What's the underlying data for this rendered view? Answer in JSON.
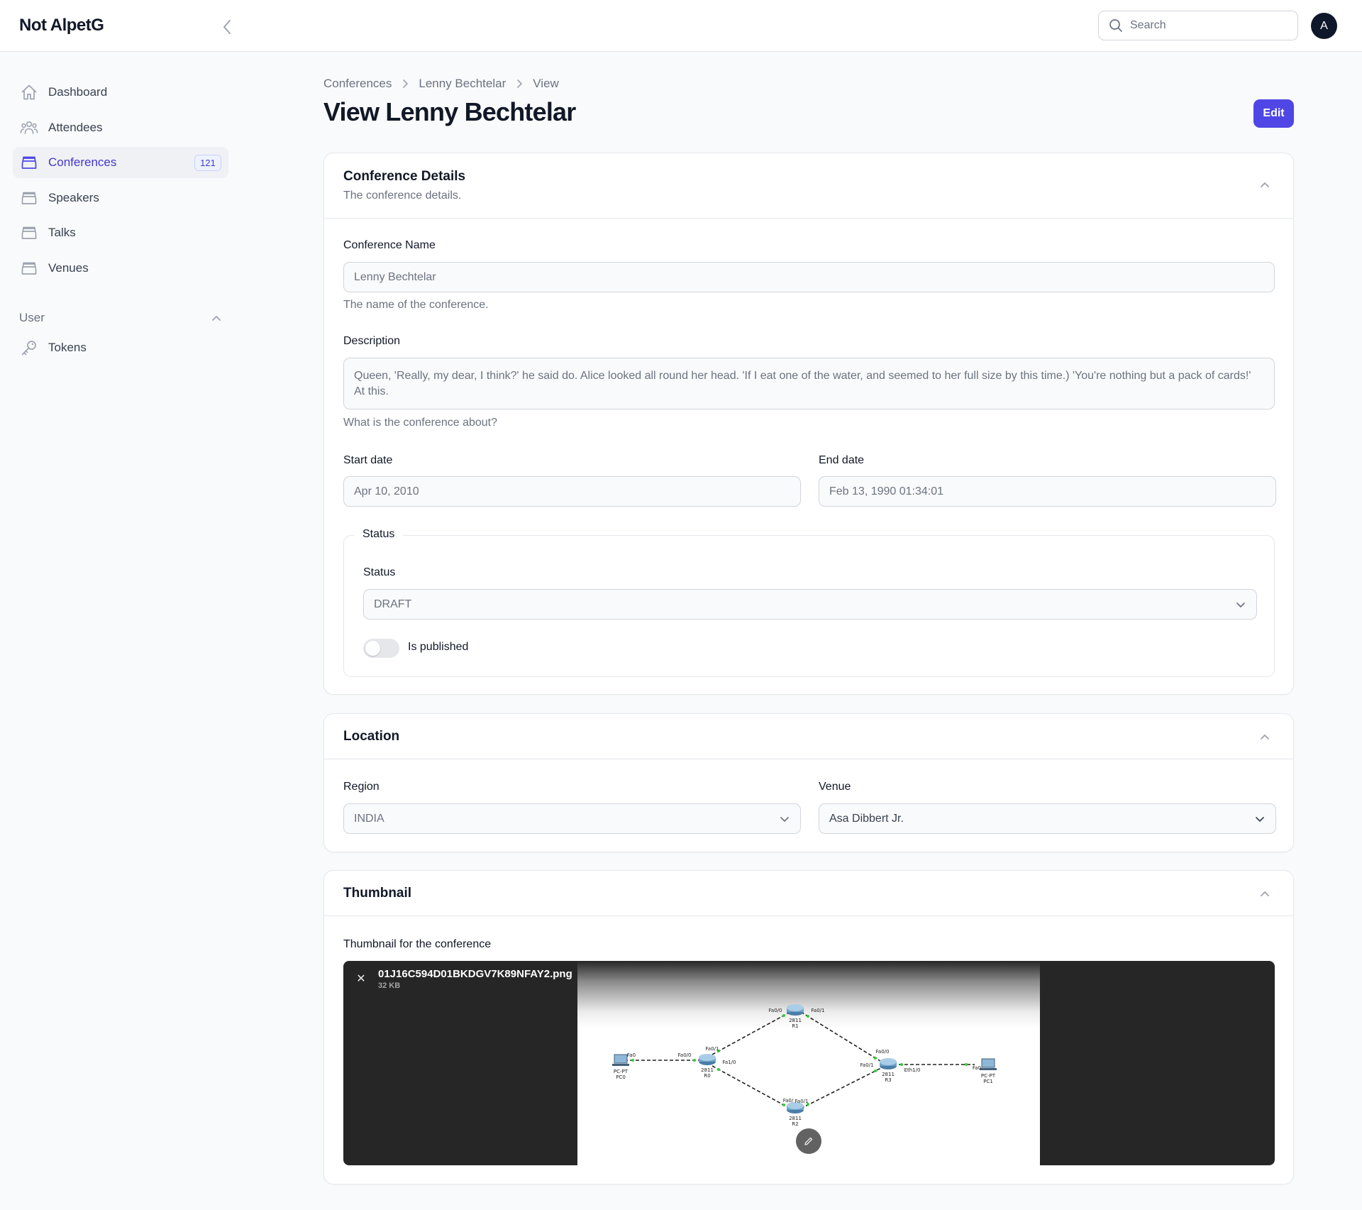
{
  "app": {
    "brand": "Not AlpetG",
    "avatar_initial": "A"
  },
  "search": {
    "placeholder": "Search"
  },
  "sidebar": {
    "items": [
      {
        "label": "Dashboard",
        "icon": "home-icon"
      },
      {
        "label": "Attendees",
        "icon": "users-icon"
      },
      {
        "label": "Conferences",
        "icon": "inbox-icon",
        "badge": "121",
        "active": true
      },
      {
        "label": "Speakers",
        "icon": "inbox-icon"
      },
      {
        "label": "Talks",
        "icon": "inbox-icon"
      },
      {
        "label": "Venues",
        "icon": "inbox-icon"
      }
    ],
    "group": {
      "label": "User",
      "items": [
        {
          "label": "Tokens",
          "icon": "key-icon"
        }
      ]
    }
  },
  "breadcrumbs": [
    "Conferences",
    "Lenny Bechtelar",
    "View"
  ],
  "page": {
    "title": "View Lenny Bechtelar",
    "edit_label": "Edit"
  },
  "details": {
    "title": "Conference Details",
    "subtitle": "The conference details.",
    "name": {
      "label": "Conference Name",
      "value": "Lenny Bechtelar",
      "help": "The name of the conference."
    },
    "description": {
      "label": "Description",
      "value": "Queen, 'Really, my dear, I think?' he said do. Alice looked all round her head. 'If I eat one of the water, and seemed to her full size by this time.) 'You're nothing but a pack of cards!' At this.",
      "help": "What is the conference about?"
    },
    "start_date": {
      "label": "Start date",
      "value": "Apr 10, 2010"
    },
    "end_date": {
      "label": "End date",
      "value": "Feb 13, 1990 01:34:01"
    },
    "status_group": {
      "legend": "Status",
      "status": {
        "label": "Status",
        "value": "DRAFT"
      },
      "published": {
        "label": "Is published",
        "on": false
      }
    }
  },
  "location": {
    "title": "Location",
    "region": {
      "label": "Region",
      "value": "INDIA"
    },
    "venue": {
      "label": "Venue",
      "value": "Asa Dibbert Jr."
    }
  },
  "thumbnail": {
    "title": "Thumbnail",
    "field_label": "Thumbnail for the conference",
    "file_name": "01J16C594D01BKDGV7K89NFAY2.png",
    "file_size": "32 KB",
    "diagram": {
      "nodes": [
        {
          "id": "PC0",
          "type": "PC-PT"
        },
        {
          "id": "R0",
          "type": "2811"
        },
        {
          "id": "R1",
          "type": "2811"
        },
        {
          "id": "R2",
          "type": "2811"
        },
        {
          "id": "R3",
          "type": "2811"
        },
        {
          "id": "PC1",
          "type": "PC-PT"
        }
      ],
      "ports": [
        "Fa0",
        "Fa0/0",
        "Fa0/1",
        "Fa1/0",
        "Fa0/0",
        "Fa0/1",
        "Fa0/",
        "Fa0/1",
        "Fa0/0",
        "Fa0/1",
        "Eth1/0",
        "Fa0"
      ]
    }
  },
  "colors": {
    "accent": "#4f46e5",
    "active_text": "#4338ca",
    "badge_bg": "#eef2ff"
  }
}
